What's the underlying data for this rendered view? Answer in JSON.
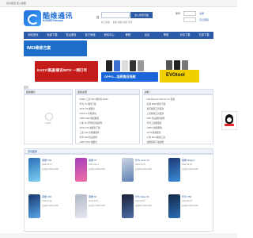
{
  "topbar": {
    "links": "设为首页  加入收藏"
  },
  "header": {
    "logo_name": "酷维通讯",
    "logo_sub": "KUWEITelecom",
    "search_label": "搜",
    "search_button": "进入搜索页面",
    "hotwords": "热门搜索：  刷机  解锁  线刷  字库",
    "login_label": "账号",
    "register": "注册",
    "forgot": "忘记密码"
  },
  "nav": {
    "items": [
      "网站首页",
      "免费下载",
      "售后服务",
      "官方商城",
      "资料中心",
      "教程",
      "论坛",
      "帮助",
      "手机下载",
      "付费下载"
    ]
  },
  "banners": [
    {
      "text": "IMEI维修方案",
      "bg": "#1d6ec9",
      "fg": "#ffffff"
    },
    {
      "text": "EASY/高通/展讯/MTK 一网打尽",
      "bg": "#c41b1b",
      "fg": "#ffffff"
    },
    {
      "text": "OPPO—加高售后线刷",
      "bg": "#1a66d8",
      "fg": "#ffffff"
    },
    {
      "text": "EVOtool",
      "bg": "#f2d000",
      "fg": "#111111"
    }
  ],
  "crumb": "首页",
  "panels": {
    "left_head": "最新图片",
    "left_percent": "100%",
    "mid_head": "最新资源",
    "right_head": "资料",
    "mid_items": [
      "· X2007 三星 S5U 刷机包 ROM",
      "· 华为 Y6 固件下载",
      "· VIVO Y5 线刷包",
      "· P40 Pro 手机驱动",
      "· OPPO A93 刷机教程",
      "· 小米 10 至尊纪念版固件",
      "· VIVO Y31 线刷包下载",
      "· 三星 S10 全网通固件",
      "· 华为 P20 售后固件",
      "· OPPO R15 线刷包"
    ],
    "right_items": [
      "· HW Remove Tool V1.1.6 更新",
      "· 高通 9008 驱动下载",
      "· 展讯刷机工具更新",
      "· 三星解锁工具更新",
      "· MTK 售后刷机说明",
      "· 华为工具箱更新",
      "· OPPO 线刷帮助",
      "· VIVO 解锁服务",
      "· 小米 MIUI 刷机工具",
      "· 线刷固件下载说明"
    ]
  },
  "gallery": {
    "title": "手机图库",
    "cards": [
      {
        "title": "荣耀 X40",
        "line1": "2023-03-21",
        "line2": "分辨率 2400×1080",
        "c1": "#2a6fb8",
        "c2": "#7fd0f0"
      },
      {
        "title": "荣耀 70",
        "line1": "2023-02-14",
        "line2": "分辨率 2400×1080",
        "c1": "#a33dbb",
        "c2": "#f26fa7"
      },
      {
        "title": "华为 nova 10",
        "line1": "2023-01-19",
        "line2": "分辨率 2400×1080",
        "c1": "#cfd6e2",
        "c2": "#5d7fb4"
      },
      {
        "title": "荣耀 Magic4",
        "line1": "2022-12-05",
        "line2": "分辨率 2400×1080",
        "c1": "#1d3a74",
        "c2": "#3c8cd9"
      },
      {
        "title": "荣耀 X30",
        "line1": "2022-11-20",
        "line2": "分辨率 2400×1080",
        "c1": "#17386e",
        "c2": "#5aa6e8"
      },
      {
        "title": "荣耀 60",
        "line1": "2022-10-11",
        "line2": "分辨率 2400×1080",
        "c1": "#b0b6c7",
        "c2": "#e5e8ef"
      },
      {
        "title": "华为 Mate 50",
        "line1": "2022-09-07",
        "line2": "分辨率 2400×1080",
        "c1": "#1b1f33",
        "c2": "#4c6fa8"
      },
      {
        "title": "华为 P50",
        "line1": "2022-08-18",
        "line2": "分辨率 2400×1080",
        "c1": "#132647",
        "c2": "#2d6fb8"
      }
    ]
  }
}
